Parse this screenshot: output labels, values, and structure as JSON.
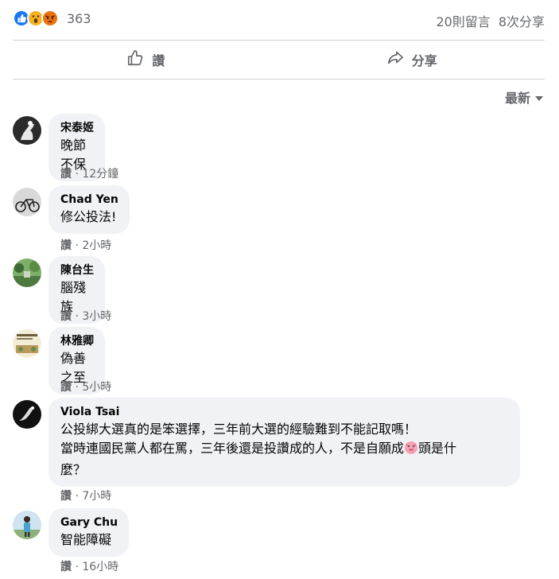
{
  "reactions": {
    "icons": [
      "like-icon",
      "wow-icon",
      "angry-icon"
    ],
    "count": "363"
  },
  "stats": {
    "comments": "20則留言",
    "shares": "8次分享"
  },
  "actions": {
    "like_label": "讚",
    "share_label": "分享"
  },
  "sort": {
    "label": "最新"
  },
  "comments": [
    {
      "author": "宋泰姬",
      "text": "晚節不保",
      "like": "讚",
      "sep": "·",
      "time": "12分鐘"
    },
    {
      "author": "Chad Yen",
      "text": "修公投法!",
      "like": "讚",
      "sep": "·",
      "time": "2小時"
    },
    {
      "author": "陳台生",
      "text": "腦殘族",
      "like": "讚",
      "sep": "·",
      "time": "3小時"
    },
    {
      "author": "林雅卿",
      "text": "偽善之至",
      "like": "讚",
      "sep": "·",
      "time": "5小時"
    },
    {
      "author": "Viola Tsai",
      "text_line1": "公投綁大選真的是笨選擇，三年前大選的經驗難到不能記取嗎！",
      "text_line2a": "當時連國民黨人都在罵，三年後還是投讚成的人，不是自願成",
      "text_line2b": "頭是什",
      "text_line3": "麼？",
      "like": "讚",
      "sep": "·",
      "time": "7小時"
    },
    {
      "author": "Gary Chu",
      "text": "智能障礙",
      "like": "讚",
      "sep": "·",
      "time": "16小時"
    }
  ],
  "colors": {
    "accent": "#1877f2",
    "bubble": "#f0f2f5",
    "muted": "#65676b",
    "divider": "#ced0d4"
  }
}
